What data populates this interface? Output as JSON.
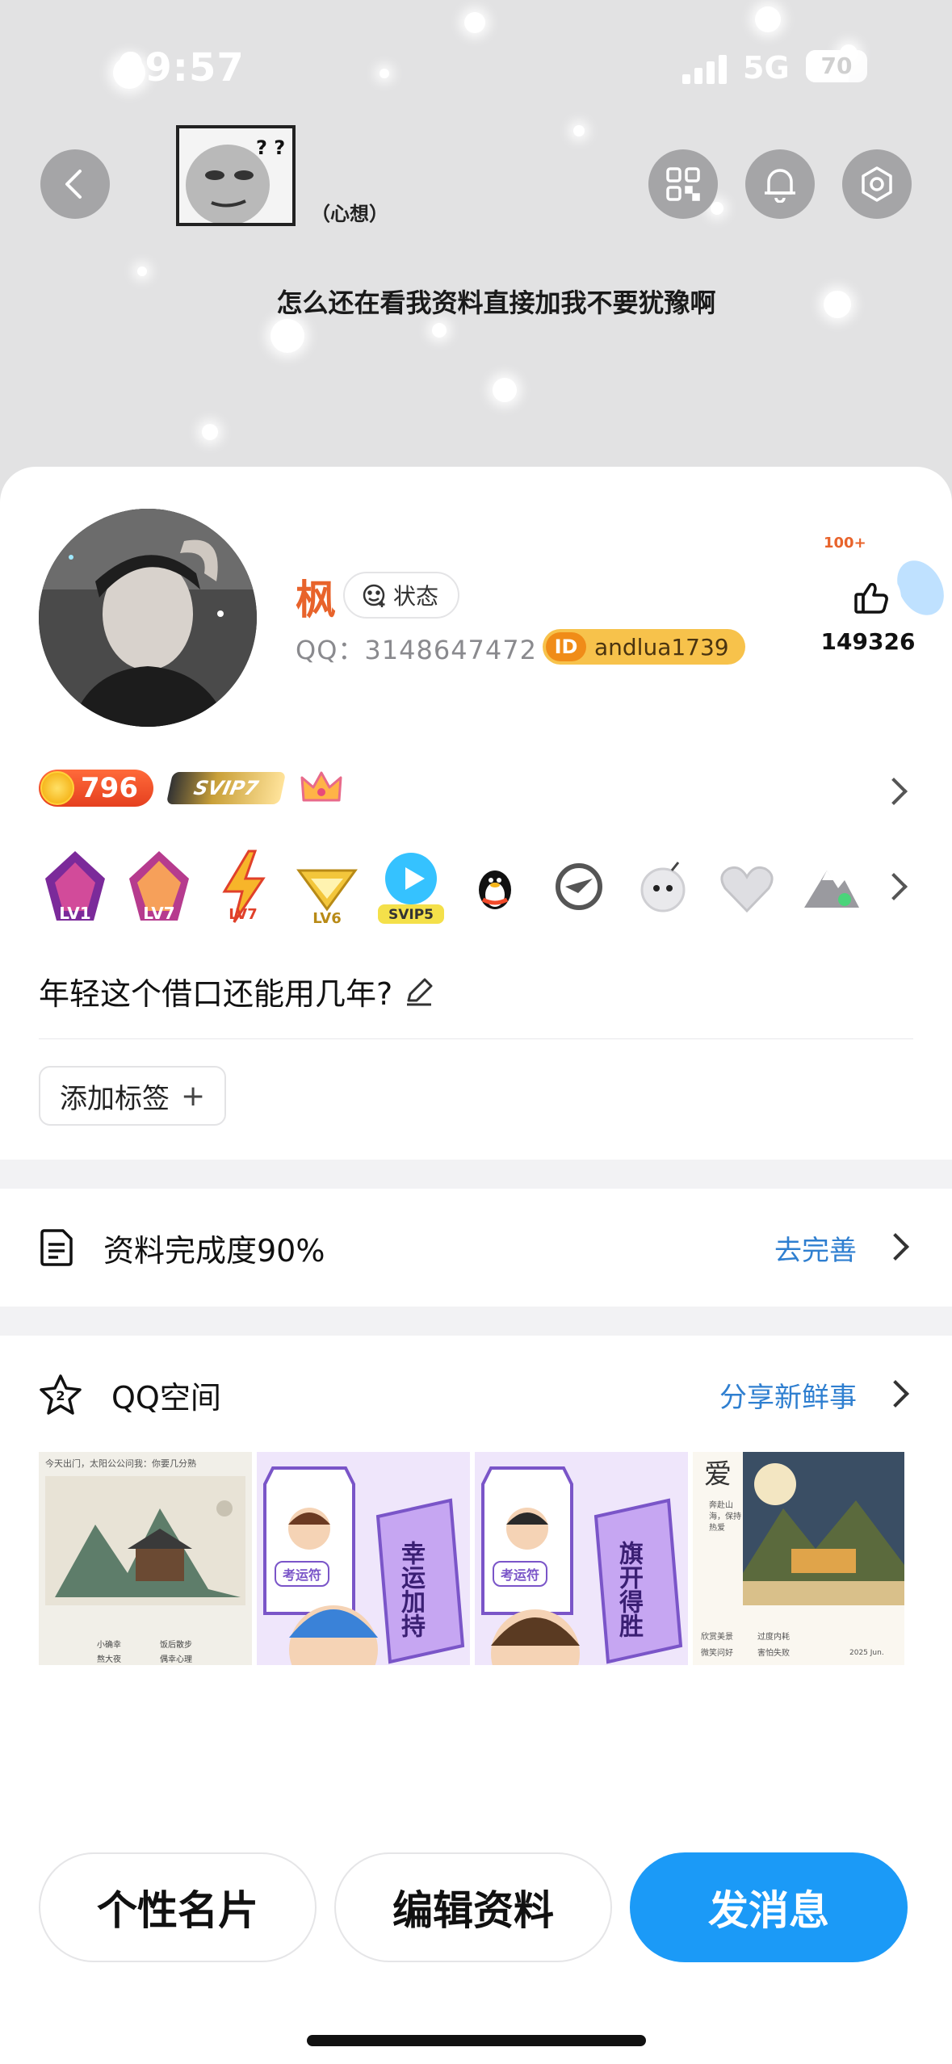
{
  "status_bar": {
    "time": "09:57",
    "network": "5G",
    "battery": "70",
    "battery_level": 0.7
  },
  "header": {
    "meme_note": "（心想）",
    "meme_text": "? ? ?",
    "caption": "怎么还在看我资料直接加我不要犹豫啊",
    "icons": [
      "back-icon",
      "qr-code-icon",
      "bell-icon",
      "settings-icon"
    ]
  },
  "profile": {
    "name": "枫",
    "status_label": "状态",
    "qq_label": "QQ：",
    "qq_number": "3148647472",
    "id_label": "ID",
    "id_handle": "andlua1739",
    "likes": "149326",
    "likes_badge": "100+",
    "points": "796",
    "svip_label": "SVIP7",
    "badges": [
      "LV1",
      "LV7",
      "LV7",
      "LV6",
      "SVIP5"
    ],
    "signature": "年轻这个借口还能用几年?",
    "add_tag_label": "添加标签",
    "add_tag_plus": "+"
  },
  "completeness": {
    "title": "资料完成度90%",
    "link": "去完善"
  },
  "qzone": {
    "title": "QQ空间",
    "link": "分享新鲜事",
    "photo1_caption": "今天出门，太阳公公问我：你要几分熟",
    "photo1_items": [
      "小确幸",
      "饭后散步",
      "熬大夜",
      "偶幸心理"
    ],
    "photo2_tag": "考运符",
    "photo2_text": "幸运加持",
    "photo3_tag": "考运符",
    "photo3_text": "旗开得胜",
    "photo4_title": "爱",
    "photo4_side": "奔赴山海，保持热爱",
    "photo4_items": [
      "欣赏美景",
      "过度内耗",
      "微笑问好",
      "害怕失败"
    ],
    "photo4_date": "2025 Jun."
  },
  "actions": {
    "card": "个性名片",
    "edit": "编辑资料",
    "message": "发消息"
  },
  "colors": {
    "accent": "#1b9af7",
    "name": "#e8632b",
    "link": "#2f7fd0"
  }
}
